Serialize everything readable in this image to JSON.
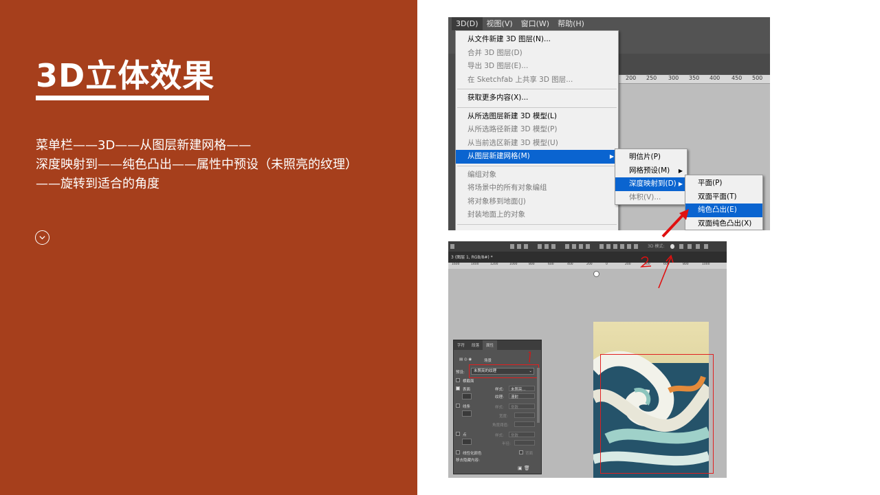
{
  "slide": {
    "title": "3D立体效果",
    "desc_lines": [
      "菜单栏——3D——从图层新建网格——",
      "深度映射到——纯色凸出——属性中预设（未照亮的纹理）",
      "——旋转到适合的角度"
    ],
    "bg_color": "#A63F1C"
  },
  "menubar": {
    "items": [
      "3D(D)",
      "视图(V)",
      "窗口(W)",
      "帮助(H)"
    ]
  },
  "dropdown": {
    "group1": [
      "从文件新建 3D 图层(N)...",
      "合并 3D 图层(D)",
      "导出 3D 图层(E)...",
      "在 Sketchfab 上共享 3D 图层..."
    ],
    "group2": [
      "获取更多内容(X)..."
    ],
    "group3": [
      "从所选图层新建 3D 模型(L)",
      "从所选路径新建 3D 模型(P)",
      "从当前选区新建 3D 模型(U)",
      "从图层新建网格(M)"
    ],
    "group4": [
      "编组对象",
      "将场景中的所有对象编组",
      "将对象移到地面(J)",
      "封装地面上的对象"
    ]
  },
  "submenu1": {
    "items": [
      "明信片(P)",
      "网格预设(M)",
      "深度映射到(D)",
      "体积(V)..."
    ]
  },
  "submenu2": {
    "items": [
      "平面(P)",
      "双面平面(T)",
      "纯色凸出(E)",
      "双面纯色凸出(X)"
    ]
  },
  "ruler1": {
    "ticks": [
      "200",
      "250",
      "300",
      "350",
      "400",
      "450",
      "500"
    ]
  },
  "shot2": {
    "doc_tab": "3 (图层 1, RGB/8#) *",
    "ruler_ticks": [
      "1600",
      "1400",
      "1200",
      "1000",
      "800",
      "600",
      "400",
      "200",
      "0",
      "200",
      "400",
      "600",
      "800",
      "1000"
    ],
    "mode_label": "3D 模式:",
    "annotations": {
      "one": "1",
      "two": "2"
    },
    "props": {
      "tabs": [
        "字符",
        "段落",
        "属性"
      ],
      "header_label": "场景",
      "preset_label": "预设:",
      "preset_value": "未照亮的纹理",
      "sections": [
        "横截面",
        "表面",
        "线条",
        "点"
      ],
      "style_label": "样式:",
      "style_value": "未照亮...",
      "texture_label": "纹理:",
      "texture_value": "漫射",
      "style2_value": "常数",
      "width_label": "宽度:",
      "angle_label": "角度阈值:",
      "radius_label": "半径:",
      "linearize": "线性化颜色",
      "remove_hidden": "移去隐藏内容:",
      "backface": "背面"
    }
  }
}
